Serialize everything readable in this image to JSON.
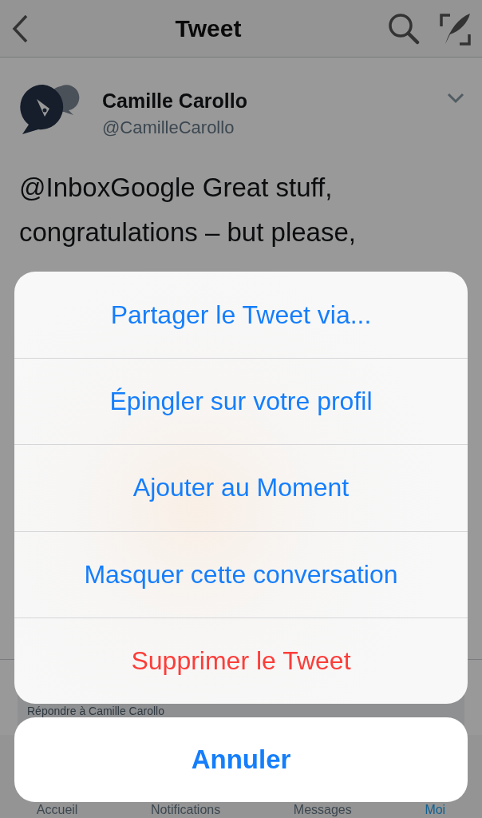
{
  "header": {
    "title": "Tweet"
  },
  "tweet": {
    "name": "Camille Carollo",
    "handle": "@CamilleCarollo",
    "text_lines": [
      "@InboxGoogle Great stuff,",
      "congratulations – but please,"
    ]
  },
  "reply": {
    "placeholder": "Répondre à Camille Carollo"
  },
  "tabs": [
    {
      "label": "Accueil",
      "selected": false
    },
    {
      "label": "Notifications",
      "selected": false
    },
    {
      "label": "Messages",
      "selected": false
    },
    {
      "label": "Moi",
      "selected": true
    }
  ],
  "action_sheet": {
    "actions": [
      {
        "label": "Partager le Tweet via...",
        "kind": "default"
      },
      {
        "label": "Épingler sur votre profil",
        "kind": "default"
      },
      {
        "label": "Ajouter au Moment",
        "kind": "default"
      },
      {
        "label": "Masquer cette conversation",
        "kind": "default"
      },
      {
        "label": "Supprimer le Tweet",
        "kind": "destructive"
      }
    ],
    "cancel": "Annuler"
  }
}
